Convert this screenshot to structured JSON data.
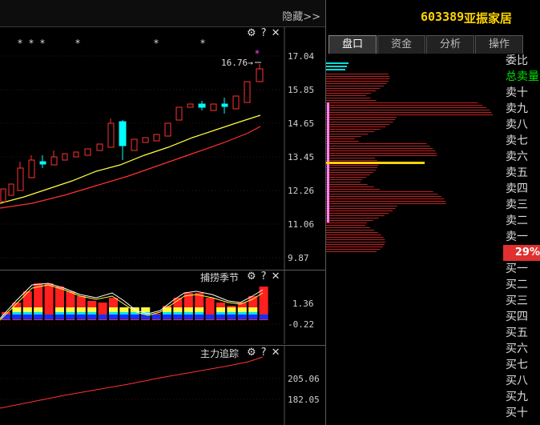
{
  "header": {
    "collapse_label": "隐藏>>",
    "stock_code": "603389",
    "stock_name": "亚振家居"
  },
  "main_panel": {
    "price_label": "16.76→",
    "price_axis": [
      "17.04",
      "15.85",
      "14.65",
      "13.45",
      "12.26",
      "11.06",
      "9.87"
    ]
  },
  "ind1": {
    "title": "捕捞季节",
    "axis": [
      "1.36",
      "-0.22"
    ]
  },
  "ind2": {
    "title": "主力追踪",
    "axis": [
      "205.06",
      "182.05"
    ]
  },
  "tabs": [
    {
      "label": "盘口"
    },
    {
      "label": "资金"
    },
    {
      "label": "分析"
    },
    {
      "label": "操作"
    }
  ],
  "side_labels": [
    "委比",
    "总卖量",
    "卖十",
    "卖九",
    "卖八",
    "卖七",
    "卖六",
    "卖五",
    "卖四",
    "卖三",
    "卖二",
    "卖一"
  ],
  "percentage": "29%",
  "side_labels_buy": [
    "买一",
    "买二",
    "买三",
    "买四",
    "买五",
    "买六",
    "买七",
    "买八",
    "买九",
    "买十"
  ],
  "colors": {
    "up": "#ff3232",
    "down": "#00ffff",
    "ma_yellow": "#ffff40",
    "accent": "#ffd400"
  }
}
